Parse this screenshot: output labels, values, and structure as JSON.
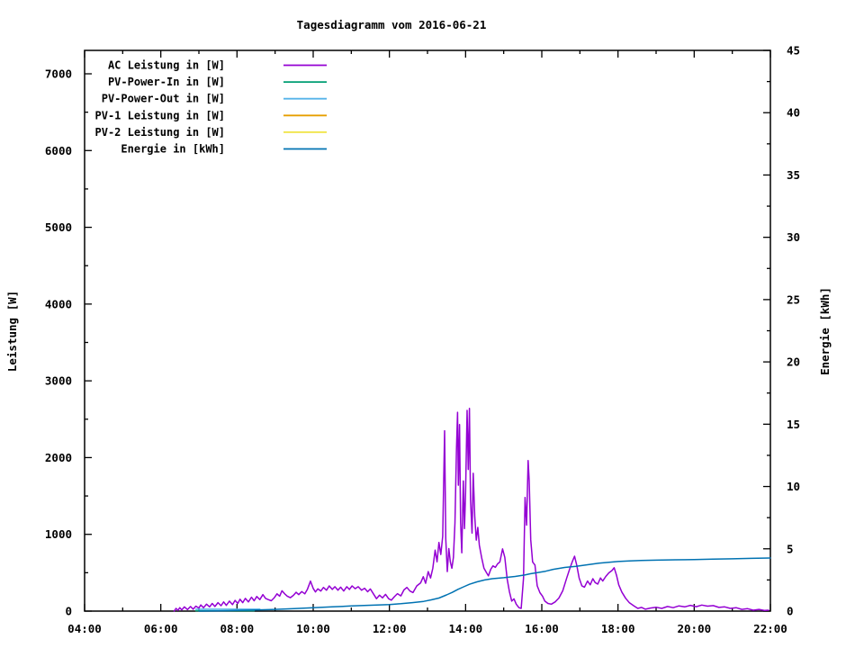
{
  "chart_data": {
    "type": "line",
    "title": "Tagesdiagramm vom 2016-06-21",
    "x_axis": {
      "unit": "time",
      "range_hours": [
        4,
        22
      ],
      "major_tick_step_hours": 2,
      "minor_tick_step_hours": 1,
      "ticks": [
        {
          "h": 4,
          "label": "04:00"
        },
        {
          "h": 6,
          "label": "06:00"
        },
        {
          "h": 8,
          "label": "08:00"
        },
        {
          "h": 10,
          "label": "10:00"
        },
        {
          "h": 12,
          "label": "12:00"
        },
        {
          "h": 14,
          "label": "14:00"
        },
        {
          "h": 16,
          "label": "16:00"
        },
        {
          "h": 18,
          "label": "18:00"
        },
        {
          "h": 20,
          "label": "20:00"
        },
        {
          "h": 22,
          "label": "22:00"
        }
      ]
    },
    "y_left": {
      "label": "Leistung [W]",
      "range": [
        0,
        7300
      ],
      "major_tick_step": 1000,
      "minor_tick_step": 500,
      "ticks": [
        {
          "v": 0,
          "label": "0"
        },
        {
          "v": 1000,
          "label": "1000"
        },
        {
          "v": 2000,
          "label": "2000"
        },
        {
          "v": 3000,
          "label": "3000"
        },
        {
          "v": 4000,
          "label": "4000"
        },
        {
          "v": 5000,
          "label": "5000"
        },
        {
          "v": 6000,
          "label": "6000"
        },
        {
          "v": 7000,
          "label": "7000"
        }
      ]
    },
    "y_right": {
      "label": "Energie [kWh]",
      "range": [
        0,
        45
      ],
      "major_tick_step": 5,
      "minor_tick_step": 2.5,
      "ticks": [
        {
          "v": 0,
          "label": "0"
        },
        {
          "v": 5,
          "label": "5"
        },
        {
          "v": 10,
          "label": "10"
        },
        {
          "v": 15,
          "label": "15"
        },
        {
          "v": 20,
          "label": "20"
        },
        {
          "v": 25,
          "label": "25"
        },
        {
          "v": 30,
          "label": "30"
        },
        {
          "v": 35,
          "label": "35"
        },
        {
          "v": 40,
          "label": "40"
        },
        {
          "v": 45,
          "label": "45"
        }
      ]
    },
    "legend_position": "top-left-inside",
    "grid": false,
    "series": [
      {
        "name": "AC Leistung in [W]",
        "color": "#9400d3",
        "axis": "left",
        "points": [
          [
            6.35,
            0
          ],
          [
            6.4,
            35
          ],
          [
            6.45,
            10
          ],
          [
            6.5,
            45
          ],
          [
            6.55,
            15
          ],
          [
            6.62,
            55
          ],
          [
            6.7,
            20
          ],
          [
            6.78,
            60
          ],
          [
            6.85,
            25
          ],
          [
            6.92,
            65
          ],
          [
            7.0,
            40
          ],
          [
            7.05,
            80
          ],
          [
            7.12,
            45
          ],
          [
            7.2,
            90
          ],
          [
            7.28,
            55
          ],
          [
            7.35,
            100
          ],
          [
            7.42,
            60
          ],
          [
            7.5,
            110
          ],
          [
            7.58,
            70
          ],
          [
            7.65,
            120
          ],
          [
            7.72,
            75
          ],
          [
            7.8,
            130
          ],
          [
            7.88,
            85
          ],
          [
            7.95,
            140
          ],
          [
            8.02,
            100
          ],
          [
            8.08,
            155
          ],
          [
            8.15,
            110
          ],
          [
            8.22,
            165
          ],
          [
            8.3,
            120
          ],
          [
            8.38,
            180
          ],
          [
            8.45,
            135
          ],
          [
            8.52,
            190
          ],
          [
            8.6,
            150
          ],
          [
            8.68,
            215
          ],
          [
            8.75,
            165
          ],
          [
            8.82,
            150
          ],
          [
            8.9,
            135
          ],
          [
            8.98,
            175
          ],
          [
            9.05,
            225
          ],
          [
            9.12,
            195
          ],
          [
            9.18,
            265
          ],
          [
            9.25,
            225
          ],
          [
            9.32,
            195
          ],
          [
            9.4,
            175
          ],
          [
            9.48,
            205
          ],
          [
            9.55,
            245
          ],
          [
            9.62,
            215
          ],
          [
            9.7,
            255
          ],
          [
            9.78,
            225
          ],
          [
            9.85,
            285
          ],
          [
            9.93,
            390
          ],
          [
            10.0,
            295
          ],
          [
            10.06,
            250
          ],
          [
            10.12,
            290
          ],
          [
            10.2,
            262
          ],
          [
            10.27,
            308
          ],
          [
            10.35,
            272
          ],
          [
            10.42,
            328
          ],
          [
            10.5,
            282
          ],
          [
            10.57,
            318
          ],
          [
            10.65,
            272
          ],
          [
            10.72,
            312
          ],
          [
            10.8,
            262
          ],
          [
            10.88,
            318
          ],
          [
            10.95,
            282
          ],
          [
            11.02,
            328
          ],
          [
            11.1,
            292
          ],
          [
            11.18,
            318
          ],
          [
            11.27,
            272
          ],
          [
            11.35,
            298
          ],
          [
            11.43,
            252
          ],
          [
            11.5,
            288
          ],
          [
            11.58,
            225
          ],
          [
            11.66,
            162
          ],
          [
            11.74,
            208
          ],
          [
            11.82,
            172
          ],
          [
            11.9,
            218
          ],
          [
            11.98,
            162
          ],
          [
            12.05,
            142
          ],
          [
            12.13,
            188
          ],
          [
            12.21,
            228
          ],
          [
            12.3,
            198
          ],
          [
            12.38,
            275
          ],
          [
            12.46,
            308
          ],
          [
            12.54,
            262
          ],
          [
            12.62,
            242
          ],
          [
            12.72,
            328
          ],
          [
            12.82,
            368
          ],
          [
            12.89,
            448
          ],
          [
            12.95,
            362
          ],
          [
            13.02,
            515
          ],
          [
            13.08,
            432
          ],
          [
            13.14,
            558
          ],
          [
            13.2,
            795
          ],
          [
            13.25,
            642
          ],
          [
            13.3,
            895
          ],
          [
            13.35,
            738
          ],
          [
            13.4,
            975
          ],
          [
            13.45,
            2350
          ],
          [
            13.48,
            940
          ],
          [
            13.52,
            515
          ],
          [
            13.56,
            815
          ],
          [
            13.6,
            640
          ],
          [
            13.64,
            558
          ],
          [
            13.68,
            700
          ],
          [
            13.72,
            1145
          ],
          [
            13.76,
            2110
          ],
          [
            13.79,
            2590
          ],
          [
            13.81,
            1640
          ],
          [
            13.84,
            2430
          ],
          [
            13.87,
            1150
          ],
          [
            13.9,
            760
          ],
          [
            13.94,
            1695
          ],
          [
            13.97,
            1075
          ],
          [
            14.0,
            1540
          ],
          [
            14.04,
            2615
          ],
          [
            14.07,
            1845
          ],
          [
            14.1,
            2640
          ],
          [
            14.13,
            1450
          ],
          [
            14.17,
            1015
          ],
          [
            14.2,
            1795
          ],
          [
            14.24,
            1230
          ],
          [
            14.28,
            925
          ],
          [
            14.32,
            1090
          ],
          [
            14.36,
            860
          ],
          [
            14.42,
            700
          ],
          [
            14.48,
            560
          ],
          [
            14.55,
            500
          ],
          [
            14.6,
            460
          ],
          [
            14.66,
            545
          ],
          [
            14.72,
            590
          ],
          [
            14.78,
            570
          ],
          [
            14.84,
            615
          ],
          [
            14.9,
            640
          ],
          [
            14.97,
            810
          ],
          [
            15.03,
            700
          ],
          [
            15.09,
            420
          ],
          [
            15.15,
            255
          ],
          [
            15.21,
            130
          ],
          [
            15.27,
            160
          ],
          [
            15.33,
            90
          ],
          [
            15.4,
            45
          ],
          [
            15.46,
            35
          ],
          [
            15.52,
            430
          ],
          [
            15.56,
            1480
          ],
          [
            15.6,
            1120
          ],
          [
            15.64,
            1960
          ],
          [
            15.67,
            1700
          ],
          [
            15.71,
            930
          ],
          [
            15.76,
            640
          ],
          [
            15.82,
            600
          ],
          [
            15.88,
            330
          ],
          [
            15.95,
            240
          ],
          [
            16.02,
            195
          ],
          [
            16.08,
            130
          ],
          [
            16.16,
            100
          ],
          [
            16.25,
            90
          ],
          [
            16.35,
            120
          ],
          [
            16.45,
            170
          ],
          [
            16.55,
            265
          ],
          [
            16.65,
            425
          ],
          [
            16.74,
            560
          ],
          [
            16.8,
            645
          ],
          [
            16.86,
            715
          ],
          [
            16.92,
            595
          ],
          [
            16.98,
            430
          ],
          [
            17.05,
            330
          ],
          [
            17.12,
            312
          ],
          [
            17.2,
            392
          ],
          [
            17.27,
            342
          ],
          [
            17.34,
            422
          ],
          [
            17.4,
            372
          ],
          [
            17.47,
            352
          ],
          [
            17.54,
            432
          ],
          [
            17.6,
            392
          ],
          [
            17.68,
            452
          ],
          [
            17.76,
            498
          ],
          [
            17.84,
            528
          ],
          [
            17.9,
            565
          ],
          [
            17.96,
            468
          ],
          [
            18.02,
            342
          ],
          [
            18.1,
            248
          ],
          [
            18.2,
            168
          ],
          [
            18.3,
            108
          ],
          [
            18.42,
            68
          ],
          [
            18.52,
            35
          ],
          [
            18.62,
            48
          ],
          [
            18.72,
            25
          ],
          [
            18.85,
            40
          ],
          [
            19.0,
            50
          ],
          [
            19.15,
            35
          ],
          [
            19.3,
            60
          ],
          [
            19.45,
            45
          ],
          [
            19.6,
            68
          ],
          [
            19.75,
            55
          ],
          [
            19.9,
            75
          ],
          [
            20.05,
            58
          ],
          [
            20.2,
            78
          ],
          [
            20.35,
            65
          ],
          [
            20.5,
            72
          ],
          [
            20.65,
            48
          ],
          [
            20.8,
            55
          ],
          [
            20.95,
            35
          ],
          [
            21.1,
            45
          ],
          [
            21.25,
            22
          ],
          [
            21.4,
            32
          ],
          [
            21.55,
            12
          ],
          [
            21.7,
            22
          ],
          [
            21.85,
            8
          ],
          [
            21.95,
            12
          ]
        ]
      },
      {
        "name": "PV-Power-In in [W]",
        "color": "#009e73",
        "axis": "left",
        "points": [
          [
            6.92,
            5
          ],
          [
            8.45,
            5
          ]
        ]
      },
      {
        "name": "PV-Power-Out in [W]",
        "color": "#56b4e9",
        "axis": "left",
        "points": [
          [
            6.92,
            25
          ],
          [
            8.6,
            25
          ]
        ]
      },
      {
        "name": "PV-1 Leistung in [W]",
        "color": "#e69f00",
        "axis": "left",
        "points": []
      },
      {
        "name": "PV-2 Leistung in [W]",
        "color": "#f0e442",
        "axis": "left",
        "points": []
      },
      {
        "name": "Energie in [kWh]",
        "color": "#0072b2",
        "axis": "right",
        "points": [
          [
            7.0,
            0
          ],
          [
            7.5,
            0.02
          ],
          [
            8.0,
            0.05
          ],
          [
            8.5,
            0.09
          ],
          [
            9.0,
            0.14
          ],
          [
            9.5,
            0.2
          ],
          [
            10.0,
            0.27
          ],
          [
            10.5,
            0.34
          ],
          [
            11.0,
            0.41
          ],
          [
            11.5,
            0.47
          ],
          [
            12.0,
            0.53
          ],
          [
            12.3,
            0.59
          ],
          [
            12.6,
            0.68
          ],
          [
            12.9,
            0.78
          ],
          [
            13.1,
            0.9
          ],
          [
            13.3,
            1.05
          ],
          [
            13.5,
            1.3
          ],
          [
            13.65,
            1.5
          ],
          [
            13.8,
            1.75
          ],
          [
            13.95,
            1.95
          ],
          [
            14.1,
            2.15
          ],
          [
            14.3,
            2.35
          ],
          [
            14.5,
            2.5
          ],
          [
            14.7,
            2.6
          ],
          [
            15.0,
            2.68
          ],
          [
            15.3,
            2.78
          ],
          [
            15.55,
            2.9
          ],
          [
            15.7,
            3.0
          ],
          [
            15.9,
            3.1
          ],
          [
            16.1,
            3.2
          ],
          [
            16.3,
            3.35
          ],
          [
            16.6,
            3.5
          ],
          [
            16.9,
            3.6
          ],
          [
            17.2,
            3.72
          ],
          [
            17.5,
            3.84
          ],
          [
            17.8,
            3.93
          ],
          [
            18.0,
            3.98
          ],
          [
            18.3,
            4.03
          ],
          [
            18.6,
            4.06
          ],
          [
            19.0,
            4.09
          ],
          [
            19.5,
            4.12
          ],
          [
            20.0,
            4.14
          ],
          [
            20.5,
            4.17
          ],
          [
            21.0,
            4.2
          ],
          [
            21.5,
            4.23
          ],
          [
            22.0,
            4.26
          ]
        ]
      }
    ]
  }
}
